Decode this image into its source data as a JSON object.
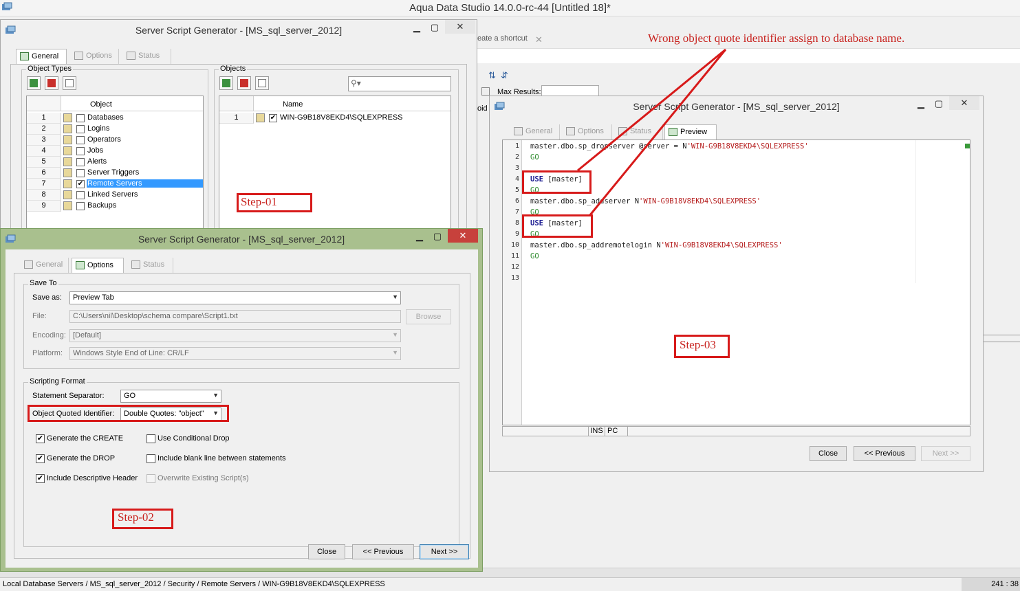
{
  "app": {
    "title": "Aqua Data Studio 14.0.0-rc-44 [Untitled 18]*"
  },
  "background": {
    "shortcut_text": "eate a shortcut",
    "max_results": "Max Results:",
    "fragment": "oid"
  },
  "dlg1": {
    "title": "Server Script Generator - [MS_sql_server_2012]",
    "tabs": [
      "General",
      "Options",
      "Status"
    ],
    "object_types_label": "Object Types",
    "objects_label": "Objects",
    "grid_header": "Object",
    "rows": [
      {
        "num": "1",
        "label": "Databases",
        "checked": ""
      },
      {
        "num": "2",
        "label": "Logins",
        "checked": ""
      },
      {
        "num": "3",
        "label": "Operators",
        "checked": ""
      },
      {
        "num": "4",
        "label": "Jobs",
        "checked": ""
      },
      {
        "num": "5",
        "label": "Alerts",
        "checked": ""
      },
      {
        "num": "6",
        "label": "Server Triggers",
        "checked": ""
      },
      {
        "num": "7",
        "label": "Remote Servers",
        "checked": "✔"
      },
      {
        "num": "8",
        "label": "Linked Servers",
        "checked": ""
      },
      {
        "num": "9",
        "label": "Backups",
        "checked": ""
      }
    ],
    "objects_header": "Name",
    "objects_row": {
      "num": "1",
      "label": "WIN-G9B18V8EKD4\\SQLEXPRESS",
      "checked": "✔"
    },
    "search_placeholder": ""
  },
  "dlg2": {
    "title": "Server Script Generator - [MS_sql_server_2012]",
    "tabs": [
      "General",
      "Options",
      "Status"
    ],
    "save_to": "Save To",
    "save_as_label": "Save as:",
    "save_as_value": "Preview Tab",
    "file_label": "File:",
    "file_value": "C:\\Users\\nil\\Desktop\\schema compare\\Script1.txt",
    "browse": "Browse",
    "encoding_label": "Encoding:",
    "encoding_value": "[Default]",
    "platform_label": "Platform:",
    "platform_value": "Windows Style End of Line: CR/LF",
    "scripting_format": "Scripting Format",
    "separator_label": "Statement Separator:",
    "separator_value": "GO",
    "quoted_label": "Object Quoted Identifier:",
    "quoted_value": "Double Quotes: \"object\"",
    "checks": {
      "gen_create": "Generate the CREATE",
      "gen_drop": "Generate the DROP",
      "desc_header": "Include Descriptive Header",
      "cond_drop": "Use Conditional Drop",
      "blank_line": "Include blank line between statements",
      "overwrite": "Overwrite Existing Script(s)"
    },
    "check_mark": "✔",
    "buttons": {
      "close": "Close",
      "previous": "<< Previous",
      "next": "Next >>"
    }
  },
  "dlg3": {
    "title": "Server Script Generator - [MS_sql_server_2012]",
    "tabs": [
      "General",
      "Options",
      "Status",
      "Preview"
    ],
    "code": [
      {
        "n": "1",
        "parts": [
          [
            "",
            "master.dbo.sp_dropserver @server = N"
          ],
          [
            "str",
            "'WIN-G9B18V8EKD4\\SQLEXPRESS'"
          ]
        ]
      },
      {
        "n": "2",
        "parts": [
          [
            "go",
            "GO"
          ]
        ]
      },
      {
        "n": "3",
        "parts": []
      },
      {
        "n": "4",
        "parts": [
          [
            "kw",
            "USE"
          ],
          [
            "",
            " [master]"
          ]
        ]
      },
      {
        "n": "5",
        "parts": [
          [
            "go",
            "GO"
          ]
        ]
      },
      {
        "n": "6",
        "parts": [
          [
            "",
            "master.dbo.sp_addserver N"
          ],
          [
            "str",
            "'WIN-G9B18V8EKD4\\SQLEXPRESS'"
          ]
        ]
      },
      {
        "n": "7",
        "parts": [
          [
            "go",
            "GO"
          ]
        ]
      },
      {
        "n": "8",
        "parts": [
          [
            "kw",
            "USE"
          ],
          [
            "",
            " [master]"
          ]
        ]
      },
      {
        "n": "9",
        "parts": [
          [
            "go",
            "GO"
          ]
        ]
      },
      {
        "n": "10",
        "parts": [
          [
            "",
            "master.dbo.sp_addremotelogin N"
          ],
          [
            "str",
            "'WIN-G9B18V8EKD4\\SQLEXPRESS'"
          ]
        ]
      },
      {
        "n": "11",
        "parts": [
          [
            "go",
            "GO"
          ]
        ]
      },
      {
        "n": "12",
        "parts": []
      },
      {
        "n": "13",
        "parts": []
      }
    ],
    "status_ins": "INS",
    "status_pc": "PC",
    "buttons": {
      "close": "Close",
      "previous": "<< Previous",
      "next": "Next >>"
    }
  },
  "annotations": {
    "step1": "Step-01",
    "step2": "Step-02",
    "step3": "Step-03",
    "note": "Wrong object quote identifier assign to database name."
  },
  "status": {
    "path": "Local Database Servers / MS_sql_server_2012 / Security / Remote Servers / WIN-G9B18V8EKD4\\SQLEXPRESS",
    "position": "241 : 38"
  }
}
